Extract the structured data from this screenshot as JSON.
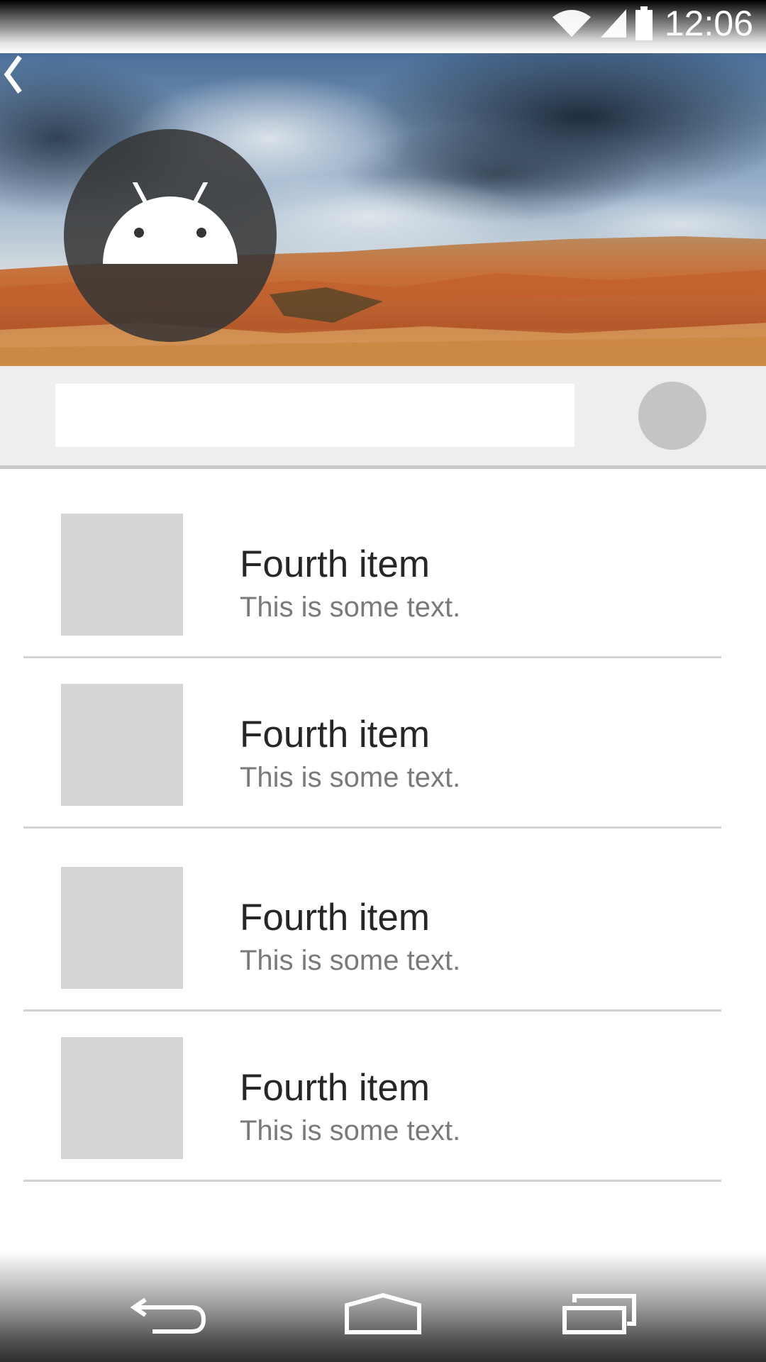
{
  "status_bar": {
    "time": "12:06",
    "icons": [
      "wifi-icon",
      "signal-icon",
      "battery-icon"
    ]
  },
  "header": {
    "back_icon": "chevron-left-icon",
    "avatar_icon": "android-icon"
  },
  "search": {
    "value": "",
    "placeholder": ""
  },
  "list": {
    "items": [
      {
        "title": "Fourth item",
        "subtitle": "This is some text."
      },
      {
        "title": "Fourth item",
        "subtitle": "This is some text."
      },
      {
        "title": "Fourth item",
        "subtitle": "This is some text."
      },
      {
        "title": "Fourth item",
        "subtitle": "This is some text."
      }
    ]
  },
  "nav_bar": {
    "buttons": [
      "back-nav-icon",
      "home-nav-icon",
      "recents-nav-icon"
    ]
  },
  "colors": {
    "search_row_bg": "#eeeeee",
    "placeholder_gray": "#d6d6d6",
    "divider": "#d2d2d2",
    "title_text": "#262626",
    "subtitle_text": "#7a7a7a"
  }
}
